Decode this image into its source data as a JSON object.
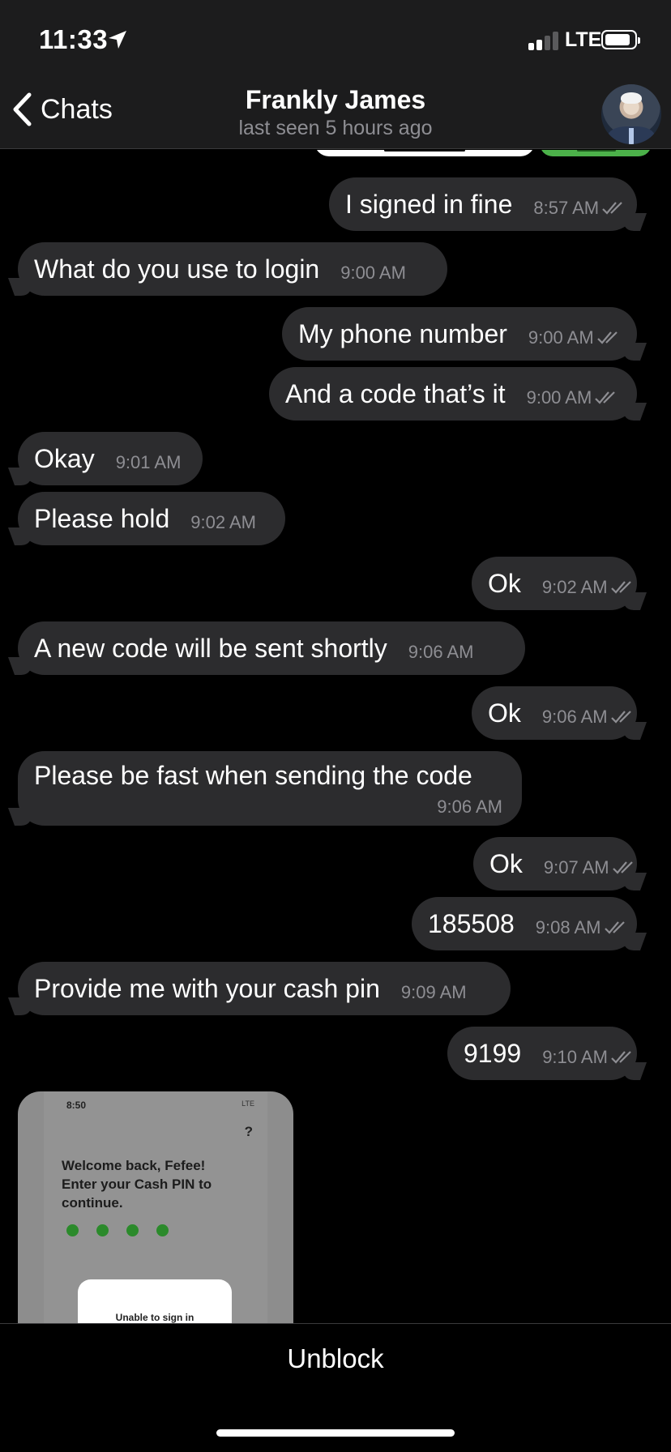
{
  "status_bar": {
    "time": "11:33",
    "network": "LTE"
  },
  "header": {
    "back_label": "Chats",
    "title": "Frankly James",
    "subtitle": "last seen 5 hours ago"
  },
  "messages": [
    {
      "dir": "out",
      "text": "I signed in fine",
      "time": "8:57 AM"
    },
    {
      "dir": "in",
      "text": "What do you use to login",
      "time": "9:00 AM"
    },
    {
      "dir": "out",
      "text": "My phone number",
      "time": "9:00 AM"
    },
    {
      "dir": "out",
      "text": "And a code that’s it",
      "time": "9:00 AM"
    },
    {
      "dir": "in",
      "text": "Okay",
      "time": "9:01 AM"
    },
    {
      "dir": "in",
      "text": "Please hold",
      "time": "9:02 AM"
    },
    {
      "dir": "out",
      "text": "Ok",
      "time": "9:02 AM"
    },
    {
      "dir": "in",
      "text": "A new code will be sent shortly",
      "time": "9:06 AM"
    },
    {
      "dir": "out",
      "text": "Ok",
      "time": "9:06 AM"
    },
    {
      "dir": "in",
      "text": "Please be fast when sending the code",
      "time": "9:06 AM"
    },
    {
      "dir": "out",
      "text": "Ok",
      "time": "9:07 AM"
    },
    {
      "dir": "out",
      "text": "185508",
      "time": "9:08 AM"
    },
    {
      "dir": "in",
      "text": "Provide me with your cash pin",
      "time": "9:09 AM"
    },
    {
      "dir": "out",
      "text": "9199",
      "time": "9:10 AM"
    }
  ],
  "screenshot_message": {
    "time": "8:50",
    "status": "LTE",
    "help": "?",
    "welcome": "Welcome back, Fefee! Enter your Cash PIN to continue.",
    "card_text": "Unable to sign in"
  },
  "bottom": {
    "action_label": "Unblock"
  },
  "colors": {
    "bubble": "#2c2c2e",
    "accent_green": "#4cb14a",
    "meta": "#8e8e93"
  }
}
